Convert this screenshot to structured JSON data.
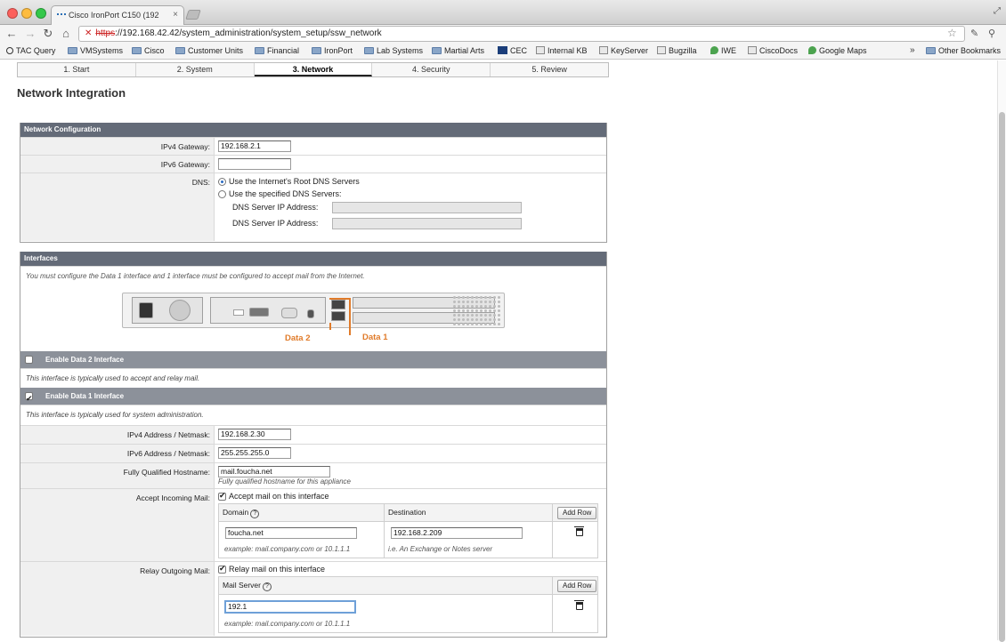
{
  "browser": {
    "tab_title": "Cisco IronPort C150 (192",
    "url_scheme": "https",
    "url_rest": "://192.168.42.42/system_administration/system_setup/ssw_network",
    "bookmarks": [
      "TAC Query",
      "VMSystems",
      "Cisco",
      "Customer Units",
      "Financial",
      "IronPort",
      "Lab Systems",
      "Martial Arts",
      "CEC",
      "Internal KB",
      "KeyServer",
      "Bugzilla",
      "IWE",
      "CiscoDocs",
      "Google Maps"
    ],
    "other_bookmarks": "Other Bookmarks"
  },
  "wizard": {
    "steps": [
      "1. Start",
      "2. System",
      "3. Network",
      "4. Security",
      "5. Review"
    ],
    "active_index": 2
  },
  "page_title": "Network Integration",
  "netconfig": {
    "header": "Network Configuration",
    "ipv4_label": "IPv4 Gateway:",
    "ipv4_value": "192.168.2.1",
    "ipv6_label": "IPv6 Gateway:",
    "ipv6_value": "",
    "dns_label": "DNS:",
    "dns_option_root": "Use the Internet's Root DNS Servers",
    "dns_option_specified": "Use the specified DNS Servers:",
    "dns_server_label_1": "DNS Server IP Address:",
    "dns_server_label_2": "DNS Server IP Address:",
    "dns_selected": "root"
  },
  "interfaces": {
    "header": "Interfaces",
    "note": "You must configure the Data 1 interface and 1 interface must be configured to accept mail from the Internet.",
    "diagram_data2": "Data 2",
    "diagram_data1": "Data 1",
    "data2": {
      "label": "Enable Data 2 Interface",
      "enabled": false,
      "desc": "This interface is typically used to accept and relay mail."
    },
    "data1": {
      "label": "Enable Data 1 Interface",
      "enabled": true,
      "desc": "This interface is typically used for system administration.",
      "ipv4_label": "IPv4 Address / Netmask:",
      "ipv4_value": "192.168.2.30",
      "ipv6_label": "IPv6 Address / Netmask:",
      "ipv6_value": "255.255.255.0",
      "fqdn_label": "Fully Qualified Hostname:",
      "fqdn_value": "mail.foucha.net",
      "fqdn_hint": "Fully qualified hostname for this appliance",
      "accept_label": "Accept Incoming Mail:",
      "accept_checkbox": "Accept mail on this interface",
      "accept_enabled": true,
      "accept_table": {
        "col_domain": "Domain",
        "col_destination": "Destination",
        "add_row": "Add Row",
        "domain_value": "foucha.net",
        "destination_value": "192.168.2.209",
        "domain_example": "example: mail.company.com or 10.1.1.1",
        "destination_example": "i.e. An Exchange or Notes server"
      },
      "relay_label": "Relay Outgoing Mail:",
      "relay_checkbox": "Relay mail on this interface",
      "relay_enabled": true,
      "relay_table": {
        "col_mail_server": "Mail Server",
        "add_row": "Add Row",
        "mail_server_value": "192.1",
        "mail_server_example": "example: mail.company.com or 10.1.1.1"
      }
    }
  }
}
